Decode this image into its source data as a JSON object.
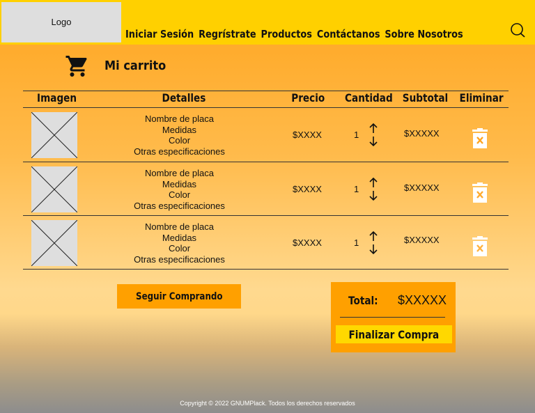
{
  "header": {
    "logo": "Logo",
    "nav": [
      "Iniciar Sesión",
      "Regrístrate",
      "Productos",
      "Contáctanos",
      "Sobre Nosotros"
    ],
    "search_icon": "search-icon",
    "bar_color": "#ffd000"
  },
  "cart": {
    "icon": "shopping-cart-icon",
    "title": "Mi carrito"
  },
  "table": {
    "columns": [
      "Imagen",
      "Detalles",
      "Precio",
      "Cantidad",
      "Subtotal",
      "Eliminar"
    ],
    "rows": [
      {
        "details": [
          "Nombre de placa",
          "Medidas",
          "Color",
          "Otras especificaciones"
        ],
        "price": "$XXXX",
        "quantity": "1",
        "subtotal": "$XXXXX"
      },
      {
        "details": [
          "Nombre de placa",
          "Medidas",
          "Color",
          "Otras especificaciones"
        ],
        "price": "$XXXX",
        "quantity": "1",
        "subtotal": "$XXXXX"
      },
      {
        "details": [
          "Nombre de placa",
          "Medidas",
          "Color",
          "Otras especificaciones"
        ],
        "price": "$XXXX",
        "quantity": "1",
        "subtotal": "$XXXXX"
      }
    ]
  },
  "actions": {
    "continue_label": "Seguir Comprando",
    "total_label": "Total:",
    "total_value": "$XXXXX",
    "checkout_label": "Finalizar Compra",
    "accent_color": "#ffa000"
  },
  "footer": {
    "copyright": "Copyright © 2022 GNUMPlack. Todos los derechos reservados"
  }
}
